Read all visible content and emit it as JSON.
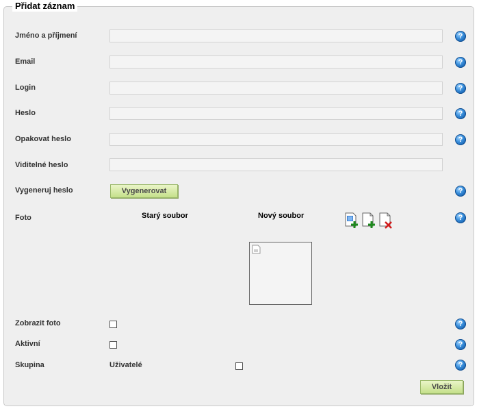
{
  "form": {
    "title": "Přidat záznam",
    "fields": {
      "name": {
        "label": "Jméno a příjmení",
        "value": ""
      },
      "email": {
        "label": "Email",
        "value": ""
      },
      "login": {
        "label": "Login",
        "value": ""
      },
      "password": {
        "label": "Heslo",
        "value": ""
      },
      "password_repeat": {
        "label": "Opakovat heslo",
        "value": ""
      },
      "visible_password": {
        "label": "Viditelné heslo",
        "value": ""
      }
    },
    "generate": {
      "label": "Vygeneruj heslo",
      "button": "Vygenerovat"
    },
    "photo": {
      "label": "Foto",
      "old_file": "Starý soubor",
      "new_file": "Nový soubor"
    },
    "show_photo": {
      "label": "Zobrazit foto",
      "checked": false
    },
    "active": {
      "label": "Aktivní",
      "checked": false
    },
    "group": {
      "label": "Skupina",
      "option_label": "Uživatelé",
      "checked": false
    },
    "help_glyph": "?",
    "submit_label": "Vložit"
  },
  "icons": {
    "help": "help-icon",
    "add_image": "add-image-file-icon",
    "add_file": "add-file-icon",
    "delete_file": "delete-file-icon",
    "broken_image": "broken-image-icon"
  },
  "colors": {
    "panel_bg": "#efefef",
    "button_green": "#c5e08a",
    "help_blue": "#3a8fdb"
  }
}
